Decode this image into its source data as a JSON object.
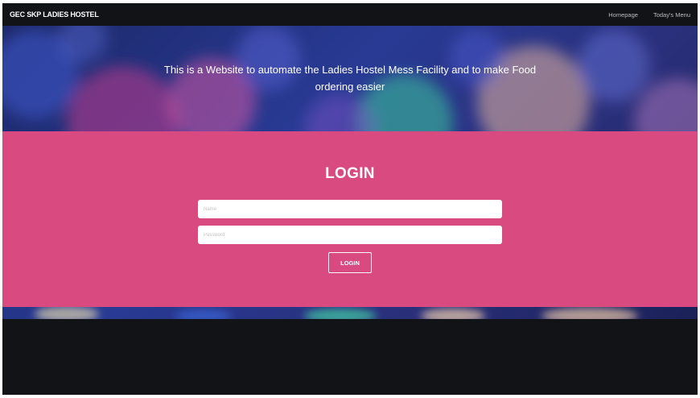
{
  "navbar": {
    "brand": "GEC SKP LADIES HOSTEL",
    "links": [
      {
        "label": "Homepage"
      },
      {
        "label": "Today's Menu"
      }
    ]
  },
  "hero": {
    "tagline_line1": "This is a Website to automate the Ladies Hostel Mess Facility and to make Food",
    "tagline_line2": "ordering easier"
  },
  "login": {
    "title": "LOGIN",
    "name_placeholder": "Name",
    "password_placeholder": "Password",
    "button_label": "LOGIN"
  },
  "colors": {
    "navbar_bg": "#111317",
    "login_band": "#d94a80",
    "hero_base": "#283a94",
    "footer_bg": "#111317"
  }
}
